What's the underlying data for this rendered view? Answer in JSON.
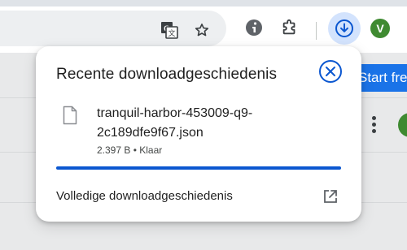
{
  "toolbar": {
    "icons": [
      "translate-icon",
      "star-icon",
      "extension-info-icon",
      "puzzle-icon",
      "download-icon"
    ],
    "avatar_letter": "V",
    "colors": {
      "avatar": "#3f8a31",
      "download_active_bg": "#d3e3fd",
      "accent": "#0b57d0"
    }
  },
  "background": {
    "button_label": "Start fre"
  },
  "download_popup": {
    "title": "Recente downloadgeschiedenis",
    "item": {
      "file_name": "tranquil-harbor-453009-q9-2c189dfe9f67.json",
      "meta": "2.397 B • Klaar",
      "progress": 1.0
    },
    "full_history_label": "Volledige downloadgeschiedenis"
  }
}
